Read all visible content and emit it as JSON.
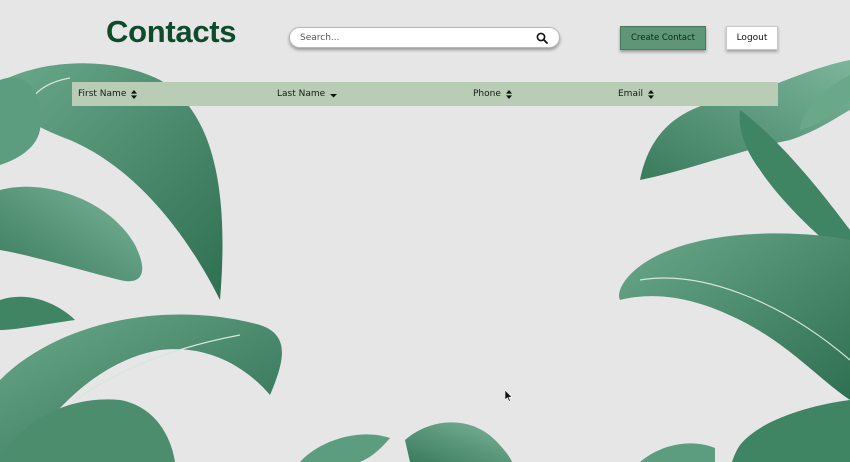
{
  "header": {
    "title": "Contacts",
    "create_label": "Create Contact",
    "logout_label": "Logout"
  },
  "search": {
    "placeholder": "Search...",
    "value": "",
    "icon": "magnifier-icon"
  },
  "table": {
    "columns": [
      {
        "label": "First Name",
        "sort": "unsorted",
        "icon": "sort-both-icon"
      },
      {
        "label": "Last Name",
        "sort": "descending",
        "icon": "sort-down-icon"
      },
      {
        "label": "Phone",
        "sort": "unsorted",
        "icon": "sort-both-icon"
      },
      {
        "label": "Email",
        "sort": "unsorted",
        "icon": "sort-both-icon"
      }
    ],
    "rows": []
  },
  "colors": {
    "title": "#0f4a2b",
    "header_row": "#b8ccb6",
    "create_button": "#5e9677",
    "background": "#e6e6e6",
    "leaf_dark": "#3f8463",
    "leaf_light": "#79b398"
  }
}
